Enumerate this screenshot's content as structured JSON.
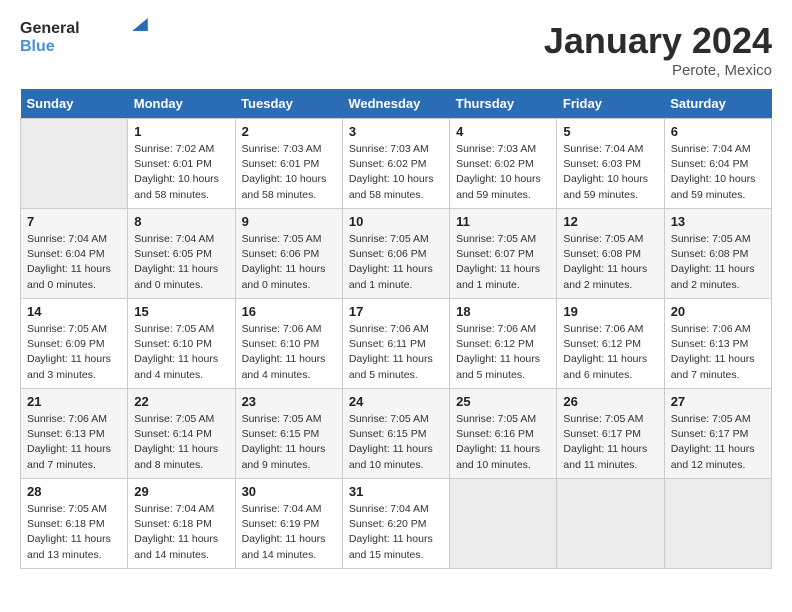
{
  "header": {
    "logo_line1": "General",
    "logo_line2": "Blue",
    "title": "January 2024",
    "subtitle": "Perote, Mexico"
  },
  "columns": [
    "Sunday",
    "Monday",
    "Tuesday",
    "Wednesday",
    "Thursday",
    "Friday",
    "Saturday"
  ],
  "weeks": [
    [
      {
        "day": "",
        "info": ""
      },
      {
        "day": "1",
        "info": "Sunrise: 7:02 AM\nSunset: 6:01 PM\nDaylight: 10 hours\nand 58 minutes."
      },
      {
        "day": "2",
        "info": "Sunrise: 7:03 AM\nSunset: 6:01 PM\nDaylight: 10 hours\nand 58 minutes."
      },
      {
        "day": "3",
        "info": "Sunrise: 7:03 AM\nSunset: 6:02 PM\nDaylight: 10 hours\nand 58 minutes."
      },
      {
        "day": "4",
        "info": "Sunrise: 7:03 AM\nSunset: 6:02 PM\nDaylight: 10 hours\nand 59 minutes."
      },
      {
        "day": "5",
        "info": "Sunrise: 7:04 AM\nSunset: 6:03 PM\nDaylight: 10 hours\nand 59 minutes."
      },
      {
        "day": "6",
        "info": "Sunrise: 7:04 AM\nSunset: 6:04 PM\nDaylight: 10 hours\nand 59 minutes."
      }
    ],
    [
      {
        "day": "7",
        "info": "Sunrise: 7:04 AM\nSunset: 6:04 PM\nDaylight: 11 hours\nand 0 minutes."
      },
      {
        "day": "8",
        "info": "Sunrise: 7:04 AM\nSunset: 6:05 PM\nDaylight: 11 hours\nand 0 minutes."
      },
      {
        "day": "9",
        "info": "Sunrise: 7:05 AM\nSunset: 6:06 PM\nDaylight: 11 hours\nand 0 minutes."
      },
      {
        "day": "10",
        "info": "Sunrise: 7:05 AM\nSunset: 6:06 PM\nDaylight: 11 hours\nand 1 minute."
      },
      {
        "day": "11",
        "info": "Sunrise: 7:05 AM\nSunset: 6:07 PM\nDaylight: 11 hours\nand 1 minute."
      },
      {
        "day": "12",
        "info": "Sunrise: 7:05 AM\nSunset: 6:08 PM\nDaylight: 11 hours\nand 2 minutes."
      },
      {
        "day": "13",
        "info": "Sunrise: 7:05 AM\nSunset: 6:08 PM\nDaylight: 11 hours\nand 2 minutes."
      }
    ],
    [
      {
        "day": "14",
        "info": "Sunrise: 7:05 AM\nSunset: 6:09 PM\nDaylight: 11 hours\nand 3 minutes."
      },
      {
        "day": "15",
        "info": "Sunrise: 7:05 AM\nSunset: 6:10 PM\nDaylight: 11 hours\nand 4 minutes."
      },
      {
        "day": "16",
        "info": "Sunrise: 7:06 AM\nSunset: 6:10 PM\nDaylight: 11 hours\nand 4 minutes."
      },
      {
        "day": "17",
        "info": "Sunrise: 7:06 AM\nSunset: 6:11 PM\nDaylight: 11 hours\nand 5 minutes."
      },
      {
        "day": "18",
        "info": "Sunrise: 7:06 AM\nSunset: 6:12 PM\nDaylight: 11 hours\nand 5 minutes."
      },
      {
        "day": "19",
        "info": "Sunrise: 7:06 AM\nSunset: 6:12 PM\nDaylight: 11 hours\nand 6 minutes."
      },
      {
        "day": "20",
        "info": "Sunrise: 7:06 AM\nSunset: 6:13 PM\nDaylight: 11 hours\nand 7 minutes."
      }
    ],
    [
      {
        "day": "21",
        "info": "Sunrise: 7:06 AM\nSunset: 6:13 PM\nDaylight: 11 hours\nand 7 minutes."
      },
      {
        "day": "22",
        "info": "Sunrise: 7:05 AM\nSunset: 6:14 PM\nDaylight: 11 hours\nand 8 minutes."
      },
      {
        "day": "23",
        "info": "Sunrise: 7:05 AM\nSunset: 6:15 PM\nDaylight: 11 hours\nand 9 minutes."
      },
      {
        "day": "24",
        "info": "Sunrise: 7:05 AM\nSunset: 6:15 PM\nDaylight: 11 hours\nand 10 minutes."
      },
      {
        "day": "25",
        "info": "Sunrise: 7:05 AM\nSunset: 6:16 PM\nDaylight: 11 hours\nand 10 minutes."
      },
      {
        "day": "26",
        "info": "Sunrise: 7:05 AM\nSunset: 6:17 PM\nDaylight: 11 hours\nand 11 minutes."
      },
      {
        "day": "27",
        "info": "Sunrise: 7:05 AM\nSunset: 6:17 PM\nDaylight: 11 hours\nand 12 minutes."
      }
    ],
    [
      {
        "day": "28",
        "info": "Sunrise: 7:05 AM\nSunset: 6:18 PM\nDaylight: 11 hours\nand 13 minutes."
      },
      {
        "day": "29",
        "info": "Sunrise: 7:04 AM\nSunset: 6:18 PM\nDaylight: 11 hours\nand 14 minutes."
      },
      {
        "day": "30",
        "info": "Sunrise: 7:04 AM\nSunset: 6:19 PM\nDaylight: 11 hours\nand 14 minutes."
      },
      {
        "day": "31",
        "info": "Sunrise: 7:04 AM\nSunset: 6:20 PM\nDaylight: 11 hours\nand 15 minutes."
      },
      {
        "day": "",
        "info": ""
      },
      {
        "day": "",
        "info": ""
      },
      {
        "day": "",
        "info": ""
      }
    ]
  ]
}
